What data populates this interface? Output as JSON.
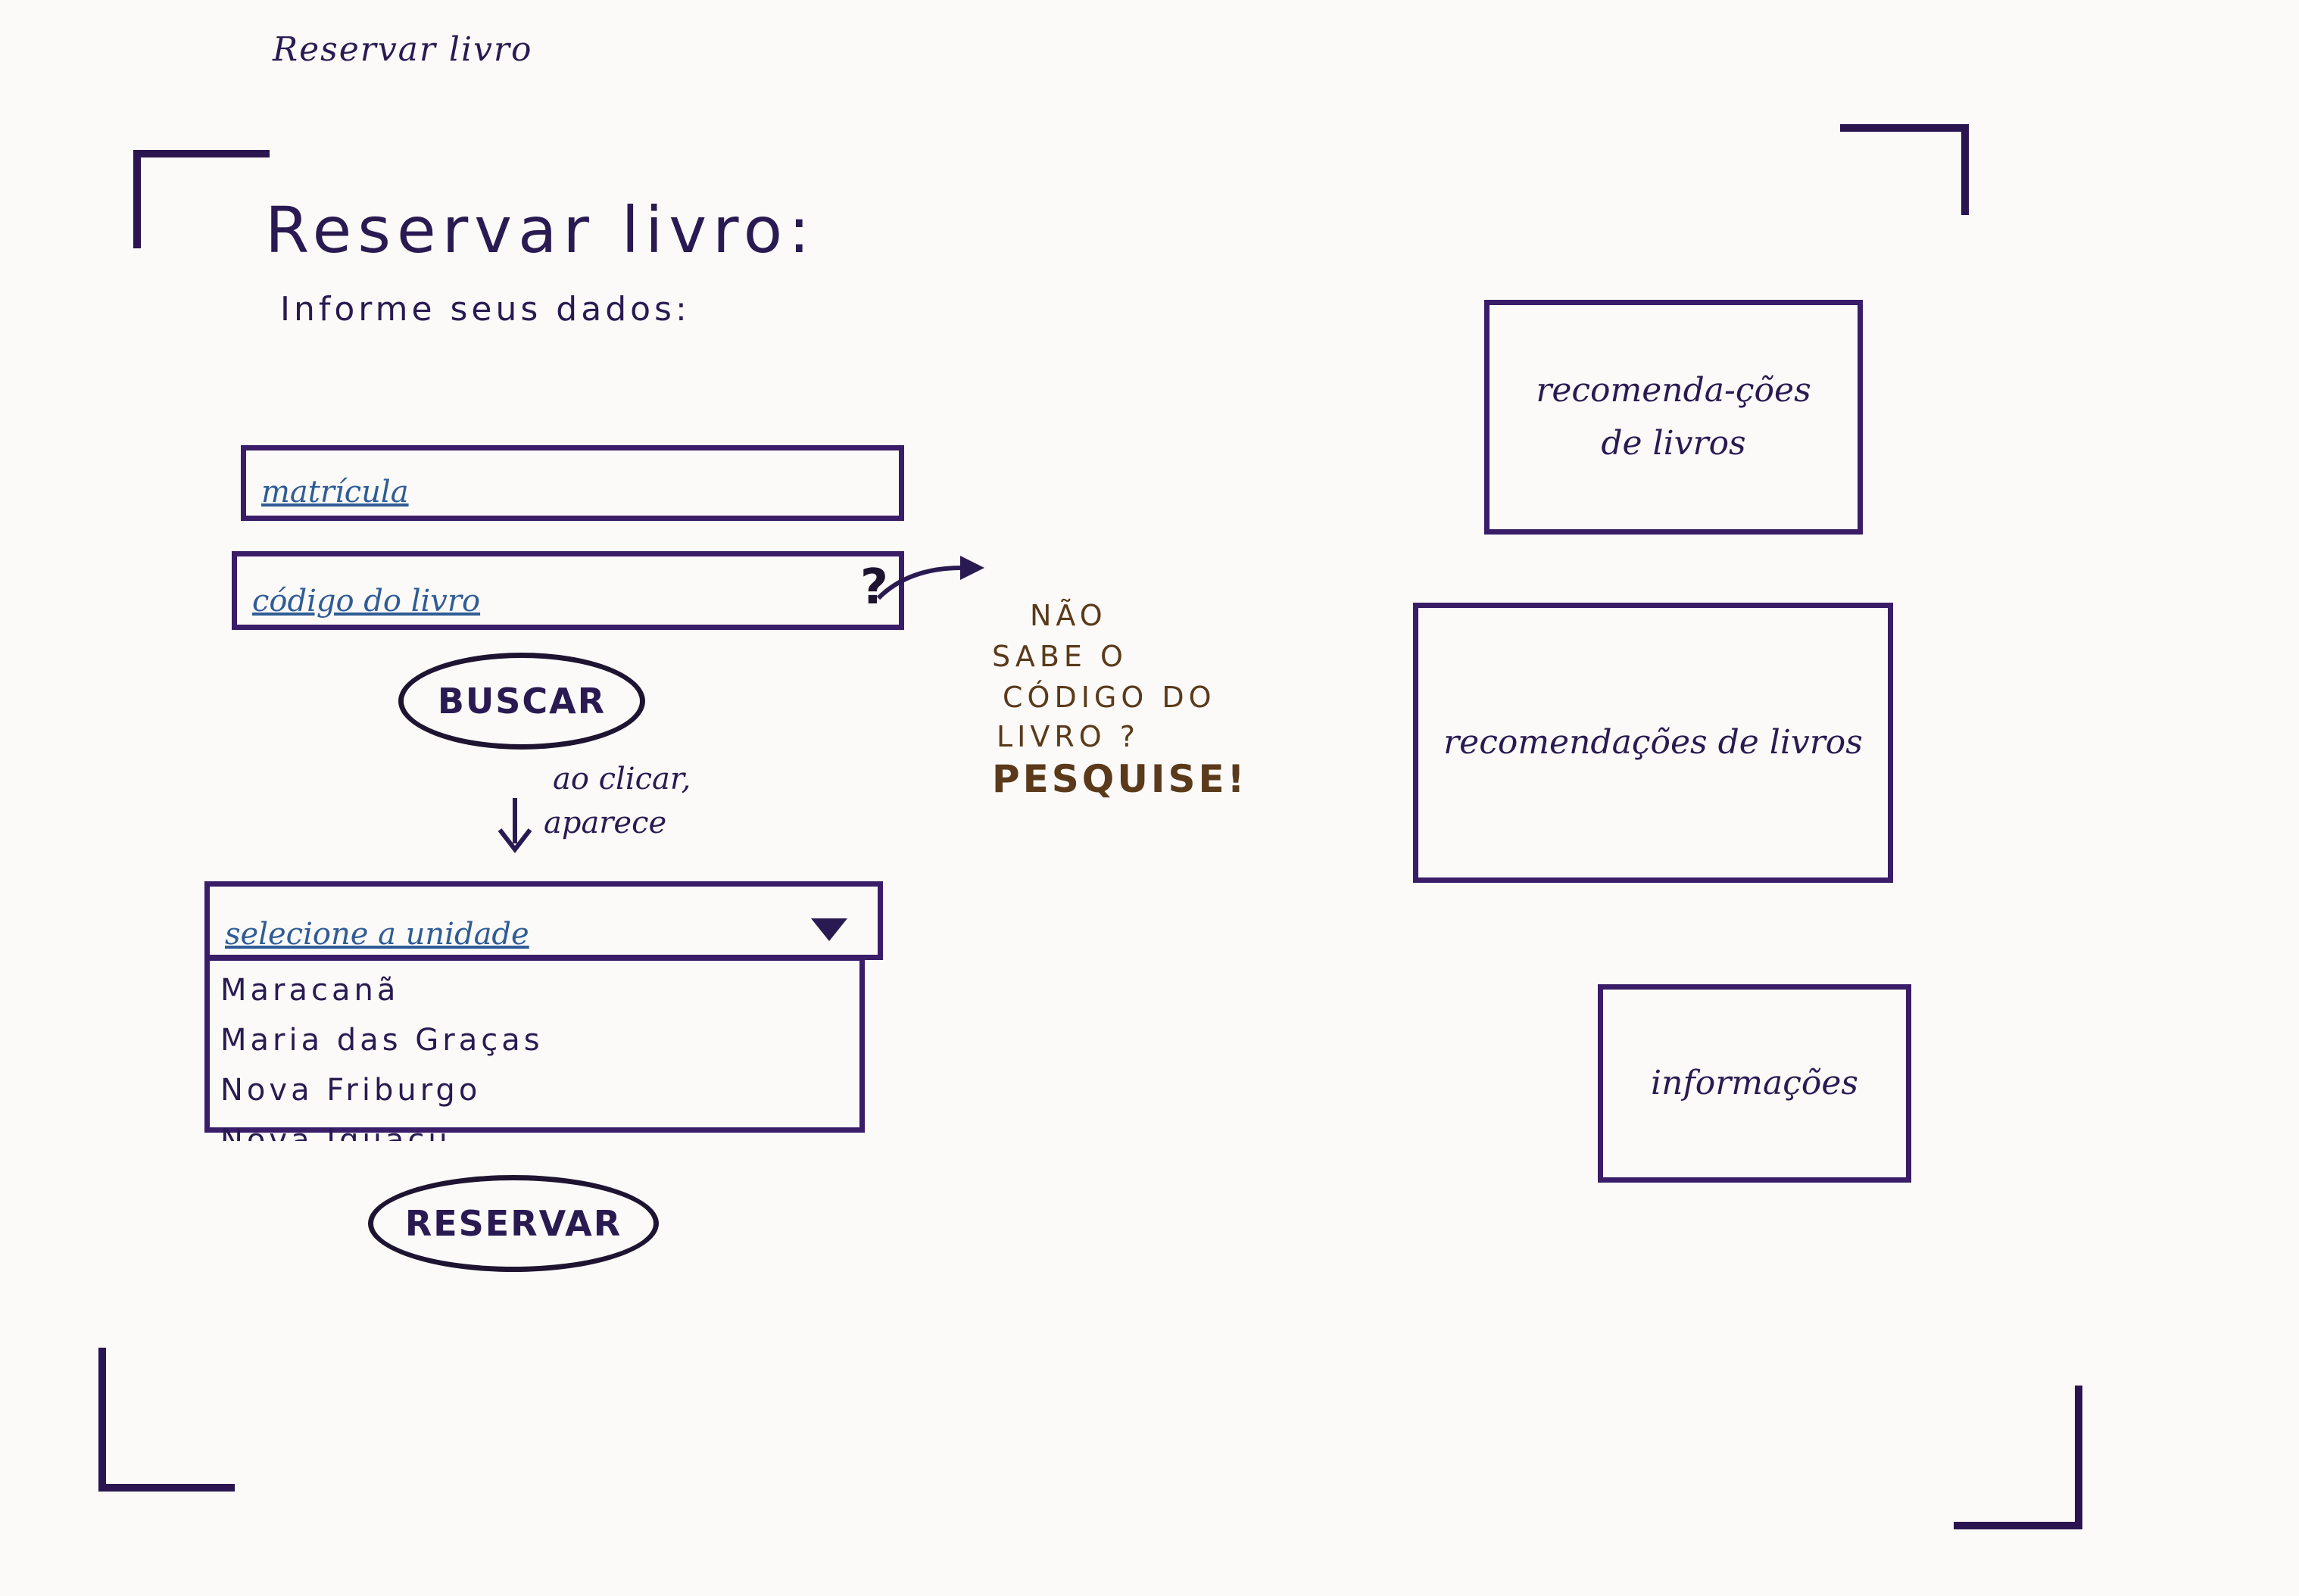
{
  "page": {
    "caption": "Reservar livro",
    "title": "Reservar livro:",
    "subtitle": "Informe seus dados:"
  },
  "form": {
    "matricula_placeholder": "matrícula",
    "book_code_placeholder": "código do livro",
    "help_symbol": "?",
    "search_button": "BUSCAR",
    "annotation_line1": "ao clicar,",
    "annotation_line2": "aparece",
    "unit_select_placeholder": "selecione a unidade",
    "unit_options": [
      "Maracanã",
      "Maria das Graças",
      "Nova Friburgo",
      "Nova Iguaçu"
    ],
    "reserve_button": "RESERVAR"
  },
  "hint": {
    "line1": "NÃO",
    "line2": "SABE O",
    "line3": "CÓDIGO DO",
    "line4": "LIVRO ?",
    "cta": "PESQUISE!"
  },
  "sidebar": {
    "recommendations_1": "recomenda-ções de livros",
    "recommendations_2": "recomendações de livros",
    "info": "informações"
  },
  "colors": {
    "frame": "#2a1550",
    "box_border": "#3a1d68",
    "placeholder_ink": "#2f5c96",
    "hint_ink": "#5a3a1a"
  }
}
